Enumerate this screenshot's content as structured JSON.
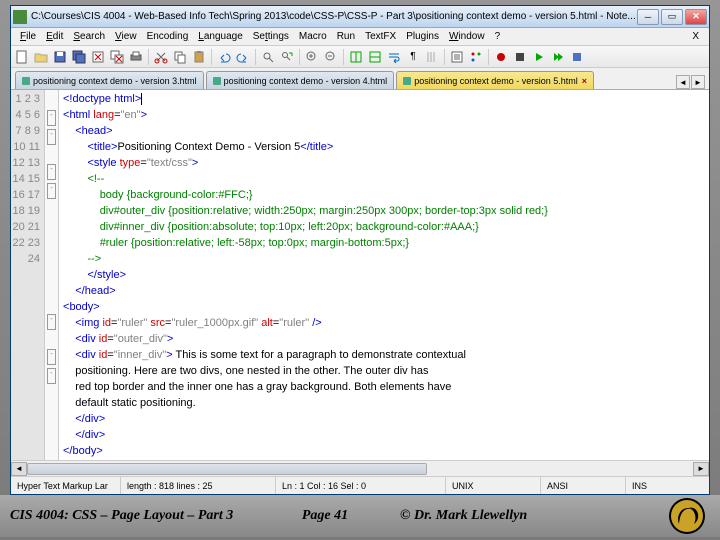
{
  "window": {
    "title": "C:\\Courses\\CIS 4004 - Web-Based Info Tech\\Spring 2013\\code\\CSS-P\\CSS-P - Part 3\\positioning context demo - version 5.html - Note..."
  },
  "menu": [
    "File",
    "Edit",
    "Search",
    "View",
    "Encoding",
    "Language",
    "Settings",
    "Macro",
    "Run",
    "TextFX",
    "Plugins",
    "Window",
    "?"
  ],
  "tabs": [
    {
      "label": "positioning context demo - version 3.html"
    },
    {
      "label": "positioning context demo - version 4.html"
    },
    {
      "label": "positioning context demo - version 5.html"
    }
  ],
  "code": {
    "lines": [
      "1",
      "2",
      "3",
      "4",
      "5",
      "6",
      "7",
      "8",
      "9",
      "10",
      "11",
      "12",
      "13",
      "14",
      "15",
      "16",
      "17",
      "18",
      "19",
      "20",
      "21",
      "22",
      "23",
      "24"
    ]
  },
  "status": {
    "lang": "Hyper Text Markup Lar",
    "length": "length : 818   lines : 25",
    "pos": "Ln : 1   Col : 16   Sel : 0",
    "os": "UNIX",
    "enc": "ANSI",
    "mode": "INS"
  },
  "footer": {
    "course": "CIS 4004: CSS – Page Layout – Part 3",
    "page": "Page 41",
    "author": "© Dr. Mark Llewellyn"
  }
}
